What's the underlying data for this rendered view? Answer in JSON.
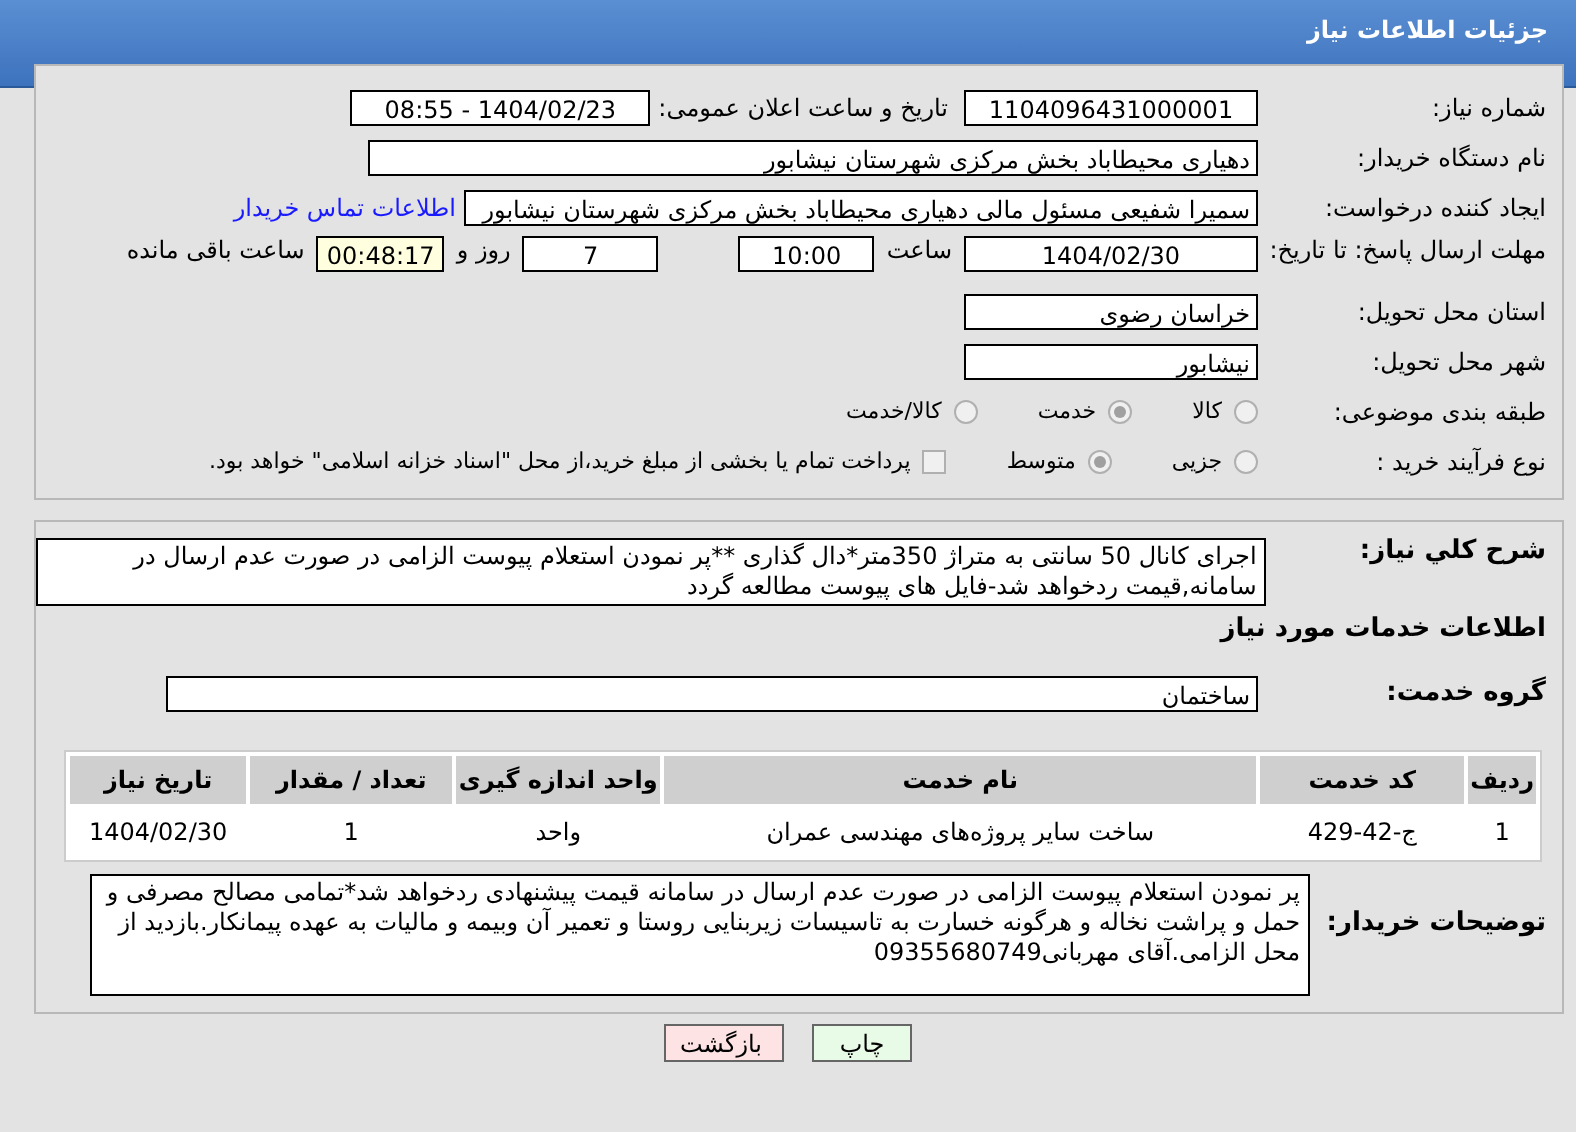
{
  "header": {
    "title": "جزئیات اطلاعات نیاز"
  },
  "details": {
    "need_number": {
      "label": "شماره نیاز:",
      "value": "1104096431000001"
    },
    "announce": {
      "label": "تاریخ و ساعت اعلان عمومی:",
      "value": "1404/02/23 - 08:55"
    },
    "buyer": {
      "label": "نام دستگاه خریدار:",
      "value": "دهیاری محیطاباد بخش مرکزی شهرستان نیشابور"
    },
    "requester": {
      "label": "ایجاد کننده درخواست:",
      "value": "سمیرا شفیعی مسئول مالی دهیاری محیطاباد بخش مرکزی شهرستان نیشابور",
      "link": "اطلاعات تماس خریدار"
    },
    "deadline": {
      "label": "مهلت ارسال پاسخ: تا تاریخ:",
      "date": "1404/02/30",
      "time_label": "ساعت",
      "time": "10:00",
      "days": "7",
      "days_label": "روز و",
      "remaining": "00:48:17",
      "remaining_label": "ساعت باقی مانده"
    },
    "province": {
      "label": "استان محل تحویل:",
      "value": "خراسان رضوی"
    },
    "city": {
      "label": "شهر محل تحویل:",
      "value": "نیشابور"
    },
    "category": {
      "label": "طبقه بندی موضوعی:",
      "options": [
        {
          "label": "کالا",
          "selected": false
        },
        {
          "label": "خدمت",
          "selected": true
        },
        {
          "label": "کالا/خدمت",
          "selected": false
        }
      ]
    },
    "process": {
      "label": "نوع فرآیند خرید :",
      "options": [
        {
          "label": "جزیی",
          "selected": false
        },
        {
          "label": "متوسط",
          "selected": true
        }
      ],
      "payment": {
        "label": "پرداخت تمام یا بخشی از مبلغ خرید،از محل \"اسناد خزانه اسلامی\" خواهد بود.",
        "checked": false
      }
    }
  },
  "summary": {
    "label": "شرح کلي نياز:",
    "value": "اجرای کانال 50 سانتی به متراژ 350متر*دال گذاری **پر نمودن استعلام پیوست الزامی در صورت عدم ارسال در سامانه,قیمت ردخواهد شد-فایل های پیوست مطالعه گردد"
  },
  "services": {
    "title": "اطلاعات خدمات مورد نیاز",
    "group_label": "گروه خدمت:",
    "group": "ساختمان",
    "table": {
      "columns": [
        "ردیف",
        "کد خدمت",
        "نام خدمت",
        "واحد اندازه گیری",
        "تعداد / مقدار",
        "تاریخ نیاز"
      ],
      "rows": [
        [
          "1",
          "ج-42-429",
          "ساخت سایر پروژه‌های مهندسی عمران",
          "واحد",
          "1",
          "1404/02/30"
        ]
      ]
    },
    "notes_label": "توضیحات خریدار:",
    "notes": "پر نمودن استعلام پیوست الزامی در صورت عدم ارسال در سامانه قیمت پیشنهادی  ردخواهد شد*تمامی مصالح مصرفی و حمل و پراشت نخاله و هرگونه خسارت به تاسیسات زیربنایی روستا و تعمیر آن وبیمه و مالیات به عهده پیمانکار.بازدید از محل الزامی.آقای مهربانی09355680749"
  },
  "buttons": [
    {
      "label": "چاپ",
      "kind": "print"
    },
    {
      "label": "بازگشت",
      "kind": "back"
    }
  ]
}
